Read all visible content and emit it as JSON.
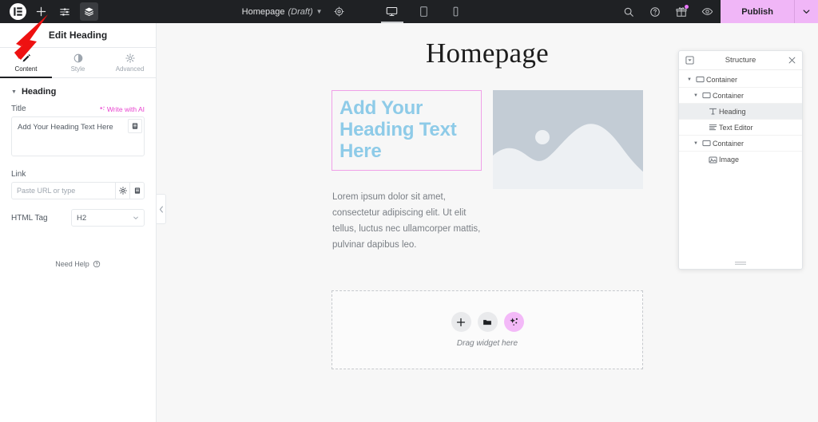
{
  "topbar": {
    "logo_icon": "elementor-logo-icon",
    "add_element_icon": "plus-icon",
    "settings_sliders_icon": "sliders-icon",
    "structure_layers_icon": "layers-icon",
    "document_title": "Homepage",
    "document_status": "(Draft)",
    "document_chevron_icon": "chevron-down-icon",
    "page_settings_icon": "gear-icon",
    "devices": [
      {
        "name": "desktop",
        "icon": "desktop-icon",
        "selected": true
      },
      {
        "name": "tablet",
        "icon": "tablet-icon",
        "selected": false
      },
      {
        "name": "mobile",
        "icon": "mobile-icon",
        "selected": false
      }
    ],
    "right_icons": [
      {
        "name": "finder",
        "icon": "search-icon"
      },
      {
        "name": "help",
        "icon": "question-circle-icon"
      },
      {
        "name": "whats-new",
        "icon": "gift-icon",
        "badge": true
      },
      {
        "name": "preview",
        "icon": "eye-icon"
      }
    ],
    "publish_label": "Publish",
    "publish_chevron_icon": "chevron-down-icon",
    "publish_color": "#f0b6f7"
  },
  "panel": {
    "header_title": "Edit Heading",
    "tabs": [
      {
        "label": "Content",
        "icon": "pencil-icon",
        "selected": true
      },
      {
        "label": "Style",
        "icon": "contrast-icon",
        "selected": false
      },
      {
        "label": "Advanced",
        "icon": "gear-icon",
        "selected": false
      }
    ],
    "section_title": "Heading",
    "section_caret_icon": "caret-down-icon",
    "title_control": {
      "label": "Title",
      "ai_link_label": "Write with AI",
      "ai_link_icon": "sparkle-icon",
      "ai_link_color": "#e843cf",
      "value": "Add Your Heading Text Here",
      "dynamic_tag_icon": "dynamic-tag-icon"
    },
    "link_control": {
      "label": "Link",
      "placeholder": "Paste URL or type",
      "value": "",
      "options_icon": "gear-icon",
      "dynamic_tag_icon": "dynamic-tag-icon"
    },
    "html_tag_control": {
      "label": "HTML Tag",
      "value": "H2",
      "chevron_icon": "chevron-down-icon"
    },
    "need_help_label": "Need Help",
    "need_help_icon": "question-circle-icon",
    "collapse_icon": "chevron-left-icon"
  },
  "canvas": {
    "site_title": "Homepage",
    "heading_widget": {
      "text": "Add Your Heading Text Here",
      "text_color": "#8ecbe8",
      "selection_border_color": "#f0a0e8"
    },
    "text_editor_widget": {
      "text": "Lorem ipsum dolor sit amet, consectetur adipiscing elit. Ut elit tellus, luctus nec ullamcorper mattis, pulvinar dapibus leo."
    },
    "image_widget": {
      "placeholder_icon": "image-placeholder-icon",
      "background_color": "#c3ccd5"
    },
    "dropzone": {
      "label": "Drag widget here",
      "buttons": [
        {
          "name": "add-widget",
          "icon": "plus-icon"
        },
        {
          "name": "add-template",
          "icon": "folder-icon"
        },
        {
          "name": "ai-builder",
          "icon": "sparkle-icon",
          "accent": "#f3b9f8"
        }
      ]
    }
  },
  "structure": {
    "collapse_all_icon": "collapse-all-icon",
    "title": "Structure",
    "close_icon": "close-icon",
    "grip_icon": "resize-grip-icon",
    "tree": [
      {
        "label": "Container",
        "icon": "container-icon",
        "depth": 0,
        "expanded": true,
        "selected": false
      },
      {
        "label": "Container",
        "icon": "container-icon",
        "depth": 1,
        "expanded": true,
        "selected": false
      },
      {
        "label": "Heading",
        "icon": "heading-icon",
        "depth": 2,
        "expanded": null,
        "selected": true
      },
      {
        "label": "Text Editor",
        "icon": "text-editor-icon",
        "depth": 2,
        "expanded": null,
        "selected": false
      },
      {
        "label": "Container",
        "icon": "container-icon",
        "depth": 1,
        "expanded": true,
        "selected": false
      },
      {
        "label": "Image",
        "icon": "image-icon",
        "depth": 2,
        "expanded": null,
        "selected": false
      }
    ]
  },
  "annotation": {
    "arrow_color": "#ee1111",
    "points_to": "add-element-button"
  }
}
